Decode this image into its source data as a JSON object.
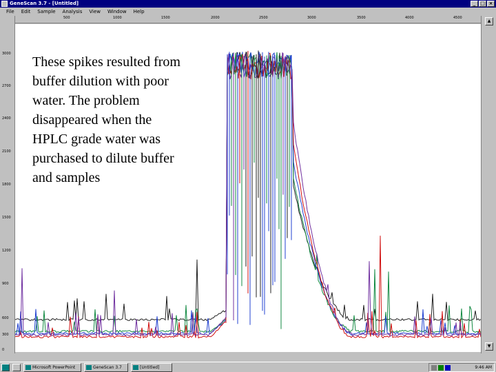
{
  "window": {
    "title": "GeneScan 3.7 - [Untitled]"
  },
  "menu": {
    "items": [
      "File",
      "Edit",
      "Sample",
      "Analysis",
      "View",
      "Window",
      "Help"
    ]
  },
  "ruler": {
    "ticks": [
      "500",
      "1000",
      "1500",
      "2000",
      "2500",
      "3000",
      "3500",
      "4000",
      "4500"
    ]
  },
  "y_axis": {
    "ticks": [
      "3000",
      "2700",
      "2400",
      "2100",
      "1800",
      "1500",
      "1200",
      "900",
      "600",
      "300",
      "0"
    ]
  },
  "annotation": {
    "lines": [
      "These spikes resulted from",
      "buffer dilution with poor",
      "water.  The problem",
      "disappeared when the",
      "HPLC grade water was",
      "purchased to dilute buffer",
      "and samples"
    ]
  },
  "taskbar": {
    "tasks": [
      "Microsoft PowerPoint",
      "GeneScan 3.7",
      "[Untitled]"
    ],
    "clock": "9:46 AM"
  },
  "colors": {
    "title_bar": "#000080",
    "trace_black": "#222222",
    "trace_blue": "#2040d0",
    "trace_green": "#108840",
    "trace_red": "#d01010",
    "trace_purple": "#7030a0"
  }
}
